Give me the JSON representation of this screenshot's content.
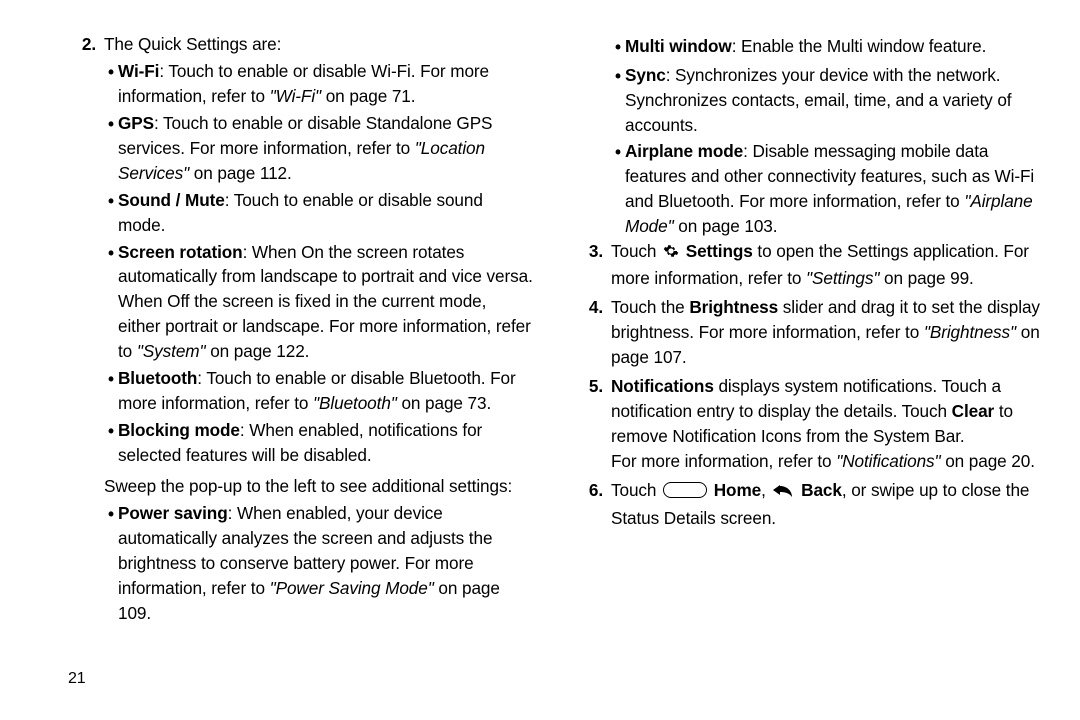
{
  "page_number": "21",
  "left": {
    "item2_num": "2.",
    "item2_lead": "The Quick Settings are:",
    "wifi_b": "Wi-Fi",
    "wifi_t": ": Touch to enable or disable Wi-Fi. For more information, refer to ",
    "wifi_i": "\"Wi-Fi\"",
    "wifi_pg": " on page 71.",
    "gps_b": "GPS",
    "gps_t": ": Touch to enable or disable Standalone GPS services. For more information, refer to ",
    "gps_i": "\"Location Services\"",
    "gps_pg": " on page 112.",
    "sound_b": "Sound / Mute",
    "sound_t": ": Touch to enable or disable sound mode.",
    "rot_b": "Screen rotation",
    "rot_t": ": When On the screen rotates automatically from landscape to portrait and vice versa. When Off the screen is fixed in the current mode, either portrait or landscape. For more information, refer to ",
    "rot_i": "\"System\"",
    "rot_pg": " on page 122.",
    "bt_b": "Bluetooth",
    "bt_t": ": Touch to enable or disable Bluetooth. For more information, refer to ",
    "bt_i": "\"Bluetooth\"",
    "bt_pg": " on page 73.",
    "block_b": "Blocking mode",
    "block_t": ": When enabled, notifications for selected features will be disabled.",
    "sweep": "Sweep the pop-up to the left to see additional settings:",
    "pow_b": "Power saving",
    "pow_t": ": When enabled, your device automatically analyzes the screen and adjusts the brightness to conserve battery power. For more information, refer to ",
    "pow_i": "\"Power Saving Mode\"",
    "pow_pg": " on page 109."
  },
  "right": {
    "mw_b": "Multi window",
    "mw_t": ": Enable the Multi window feature.",
    "sync_b": "Sync",
    "sync_t": ": Synchronizes your device with the network. Synchronizes contacts, email, time, and a variety of accounts.",
    "air_b": "Airplane mode",
    "air_t": ": Disable messaging mobile data features and other connectivity features, such as Wi-Fi and Bluetooth. For more information, refer to ",
    "air_i": "\"Airplane Mode\"",
    "air_pg": " on page 103.",
    "item3_num": "3.",
    "item3_a": "Touch ",
    "item3_set": "Settings",
    "item3_b": " to open the Settings application. For more information, refer to ",
    "item3_i": "\"Settings\"",
    "item3_pg": " on page 99.",
    "item4_num": "4.",
    "item4_a": "Touch the ",
    "item4_br": "Brightness",
    "item4_b": " slider and drag it to set the display brightness. For more information, refer to ",
    "item4_i": "\"Brightness\"",
    "item4_pg": " on page 107.",
    "item5_num": "5.",
    "item5_nb": "Notifications",
    "item5_a": " displays system notifications. Touch a notification entry to display the details. Touch ",
    "item5_clr": "Clear",
    "item5_b": " to remove Notification Icons from the System Bar.",
    "item5_c": "For more information, refer to ",
    "item5_i": "\"Notifications\"",
    "item5_pg": " on page 20.",
    "item6_num": "6.",
    "item6_a": "Touch ",
    "item6_home": "Home",
    "item6_sep": ", ",
    "item6_back": "Back",
    "item6_b": ", or swipe up to close the Status Details screen."
  }
}
